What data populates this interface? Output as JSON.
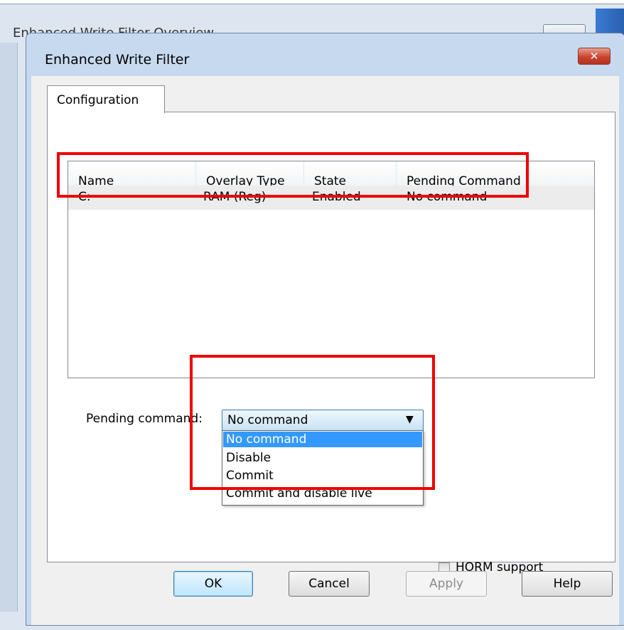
{
  "background_window": {
    "title": "Enhanced Write Filter Overview"
  },
  "dialog": {
    "title": "Enhanced Write Filter",
    "close_glyph": "✕",
    "tabs": [
      {
        "label": "Configuration"
      }
    ],
    "list": {
      "columns": [
        "Name",
        "Overlay Type",
        "State",
        "Pending Command"
      ],
      "rows": [
        {
          "name": "C:",
          "overlay_type": "RAM (Reg)",
          "state": "Enabled",
          "pending_command": "No command"
        }
      ]
    },
    "pending_command": {
      "label": "Pending command:",
      "selected": "No command",
      "options": [
        "No command",
        "Disable",
        "Commit",
        "Commit and disable live"
      ]
    },
    "horm_support": {
      "label": "HORM support",
      "checked": false
    },
    "buttons": {
      "ok": "OK",
      "cancel": "Cancel",
      "apply": "Apply",
      "help": "Help"
    }
  },
  "colors": {
    "highlight_box": "#ee0000",
    "selection": "#3399ff",
    "title_bar": "#c7d9ef"
  },
  "icons": {
    "close": "close-icon",
    "dropdown": "chevron-down-icon"
  }
}
